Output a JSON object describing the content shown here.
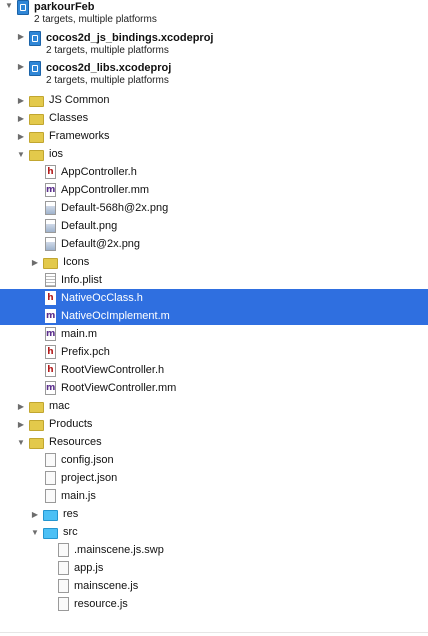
{
  "root": {
    "name": "parkourFeb",
    "subtitle": "2 targets, multiple platforms"
  },
  "subprojects": [
    {
      "name": "cocos2d_js_bindings.xcodeproj",
      "subtitle": "2 targets, multiple platforms"
    },
    {
      "name": "cocos2d_libs.xcodeproj",
      "subtitle": "2 targets, multiple platforms"
    }
  ],
  "groups": {
    "js_common": "JS Common",
    "classes": "Classes",
    "frameworks": "Frameworks",
    "ios": "ios",
    "mac": "mac",
    "products": "Products",
    "resources": "Resources"
  },
  "ios_items": [
    {
      "name": "AppController.h",
      "icon": "header-file-icon"
    },
    {
      "name": "AppController.mm",
      "icon": "objc-file-icon"
    },
    {
      "name": "Default-568h@2x.png",
      "icon": "image-file-icon"
    },
    {
      "name": "Default.png",
      "icon": "image-file-icon"
    },
    {
      "name": "Default@2x.png",
      "icon": "image-file-icon"
    },
    {
      "name": "Icons",
      "icon": "folder-icon"
    },
    {
      "name": "Info.plist",
      "icon": "plist-file-icon"
    },
    {
      "name": "NativeOcClass.h",
      "icon": "header-file-icon",
      "selected": true
    },
    {
      "name": "NativeOcImplement.m",
      "icon": "objc-file-icon",
      "selected": true
    },
    {
      "name": "main.m",
      "icon": "objc-file-icon"
    },
    {
      "name": "Prefix.pch",
      "icon": "header-file-icon"
    },
    {
      "name": "RootViewController.h",
      "icon": "header-file-icon"
    },
    {
      "name": "RootViewController.mm",
      "icon": "objc-file-icon"
    }
  ],
  "resources_items": [
    {
      "name": "config.json"
    },
    {
      "name": "project.json"
    },
    {
      "name": "main.js"
    }
  ],
  "res_folder": "res",
  "src_folder": "src",
  "src_items": [
    {
      "name": ".mainscene.js.swp"
    },
    {
      "name": "app.js"
    },
    {
      "name": "mainscene.js"
    },
    {
      "name": "resource.js"
    }
  ],
  "colors": {
    "selection": "#2f6fe0",
    "folder_yellow": "#e3c94b",
    "folder_blue": "#4cc0f5"
  }
}
